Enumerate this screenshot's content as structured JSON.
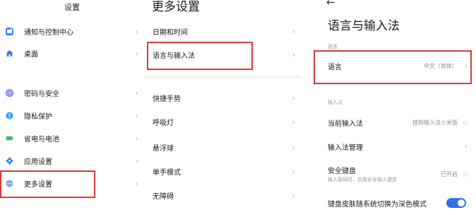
{
  "settings_panel": {
    "title": "设置",
    "items": [
      {
        "label": "通知与控制中心",
        "icon": "notification-icon",
        "color": "#2f7cf6"
      },
      {
        "label": "桌面",
        "icon": "home-icon",
        "color": "#3a6fe8"
      },
      {
        "label": "密码与安全",
        "icon": "fingerprint-icon",
        "color": "#5a5ee8"
      },
      {
        "label": "隐私保护",
        "icon": "privacy-icon",
        "color": "#2f9bf5"
      },
      {
        "label": "省电与电池",
        "icon": "battery-icon",
        "color": "#2fbf6a"
      },
      {
        "label": "应用设置",
        "icon": "gear-icon",
        "color": "#2f7cf6"
      },
      {
        "label": "更多设置",
        "icon": "more-icon",
        "color": "#8aa6d6"
      }
    ]
  },
  "more_settings_panel": {
    "title": "更多设置",
    "items": [
      {
        "label": "日期和时间"
      },
      {
        "label": "语言与输入法"
      },
      {
        "label": "快捷手势"
      },
      {
        "label": "呼吸灯"
      },
      {
        "label": "悬浮球"
      },
      {
        "label": "单手模式"
      },
      {
        "label": "无障碍"
      }
    ]
  },
  "language_panel": {
    "back_icon": "back-arrow-icon",
    "back_glyph": "←",
    "title": "语言与输入法",
    "language_section": "语言",
    "language_label": "语言",
    "language_value": "中文（简体）",
    "input_section": "输入法",
    "current_ime_label": "当前输入法",
    "current_ime_value": "搜狗输入法小米版",
    "ime_manage_label": "输入法管理",
    "secure_kb_label": "安全键盘",
    "secure_kb_sub": "输入密码时，启用安全输入键盘",
    "secure_kb_value": "已开启",
    "dark_kb_label": "键盘皮肤随系统切换为深色模式",
    "dark_kb_enabled": true
  },
  "colors": {
    "highlight": "#d63a3a",
    "toggle_on": "#2f72e4"
  }
}
